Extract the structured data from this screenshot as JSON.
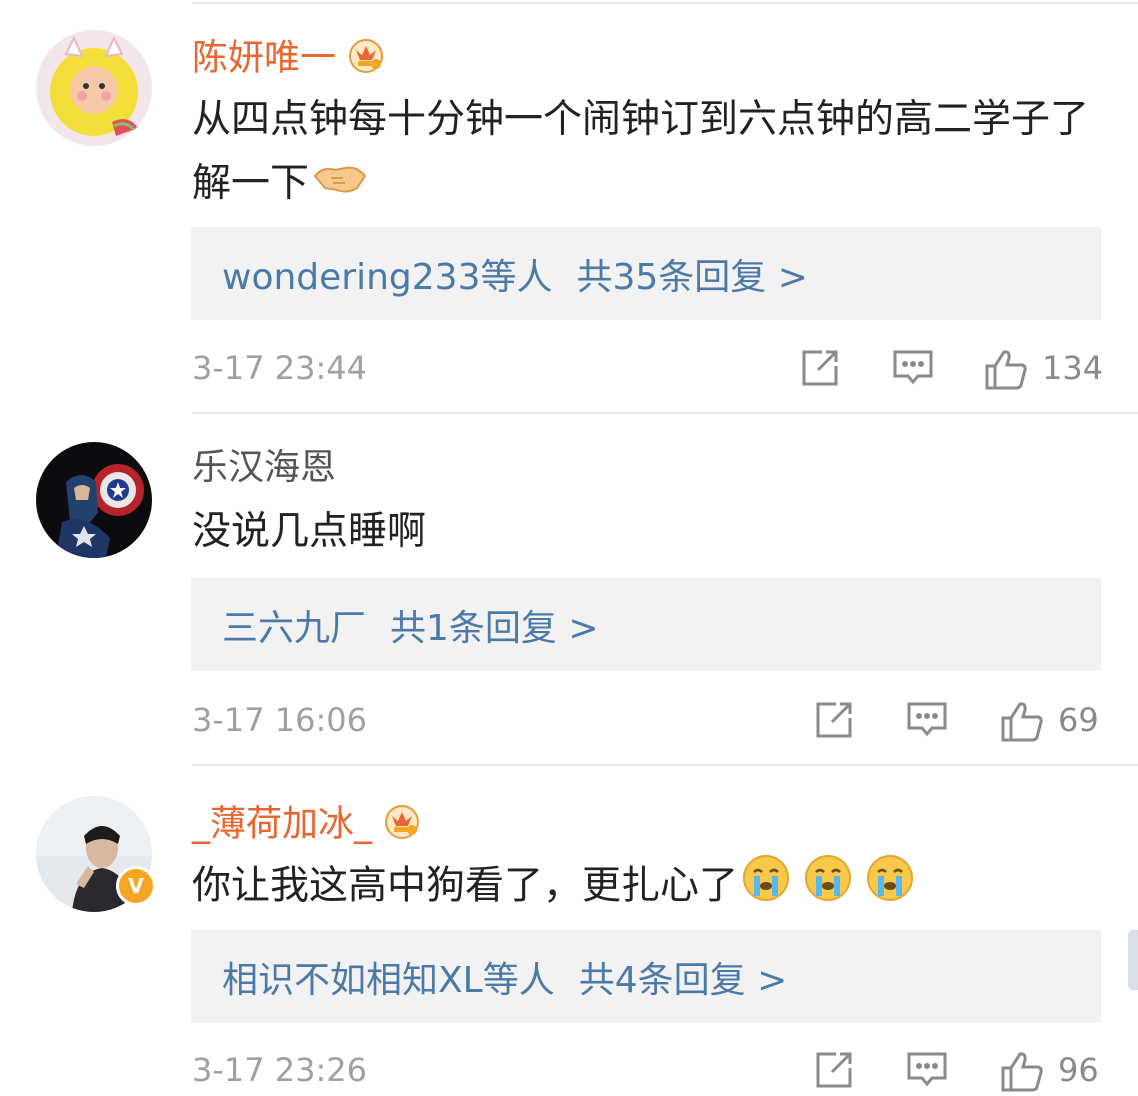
{
  "comments": [
    {
      "username": "陈妍唯一",
      "user_style": "vip",
      "badge": "crown",
      "text": "从四点钟每十分钟一个闹钟订到六点钟的高二学子了解一下",
      "text_emoji": "handshake",
      "reply_users": "wondering233等人",
      "reply_count": "共35条回复 >",
      "time": "3-17 23:44",
      "likes": "134"
    },
    {
      "username": "乐汉海恩",
      "user_style": "normal",
      "text": "没说几点睡啊",
      "reply_users": "三六九厂",
      "reply_count": "共1条回复 >",
      "time": "3-17 16:06",
      "likes": "69"
    },
    {
      "username": "_薄荷加冰_",
      "user_style": "vip",
      "badge": "crown",
      "verified_badge": "V",
      "text": "你让我这高中狗看了，更扎心了",
      "text_emoji": "crying-face x3",
      "reply_users": "相识不如相知XL等人",
      "reply_count": "共4条回复 >",
      "time": "3-17 23:26",
      "likes": "96"
    }
  ],
  "colors": {
    "vip_name": "#e8662f",
    "link": "#4c7aa8",
    "reply_bg": "#f2f2f2",
    "meta": "#a0a0a0"
  }
}
